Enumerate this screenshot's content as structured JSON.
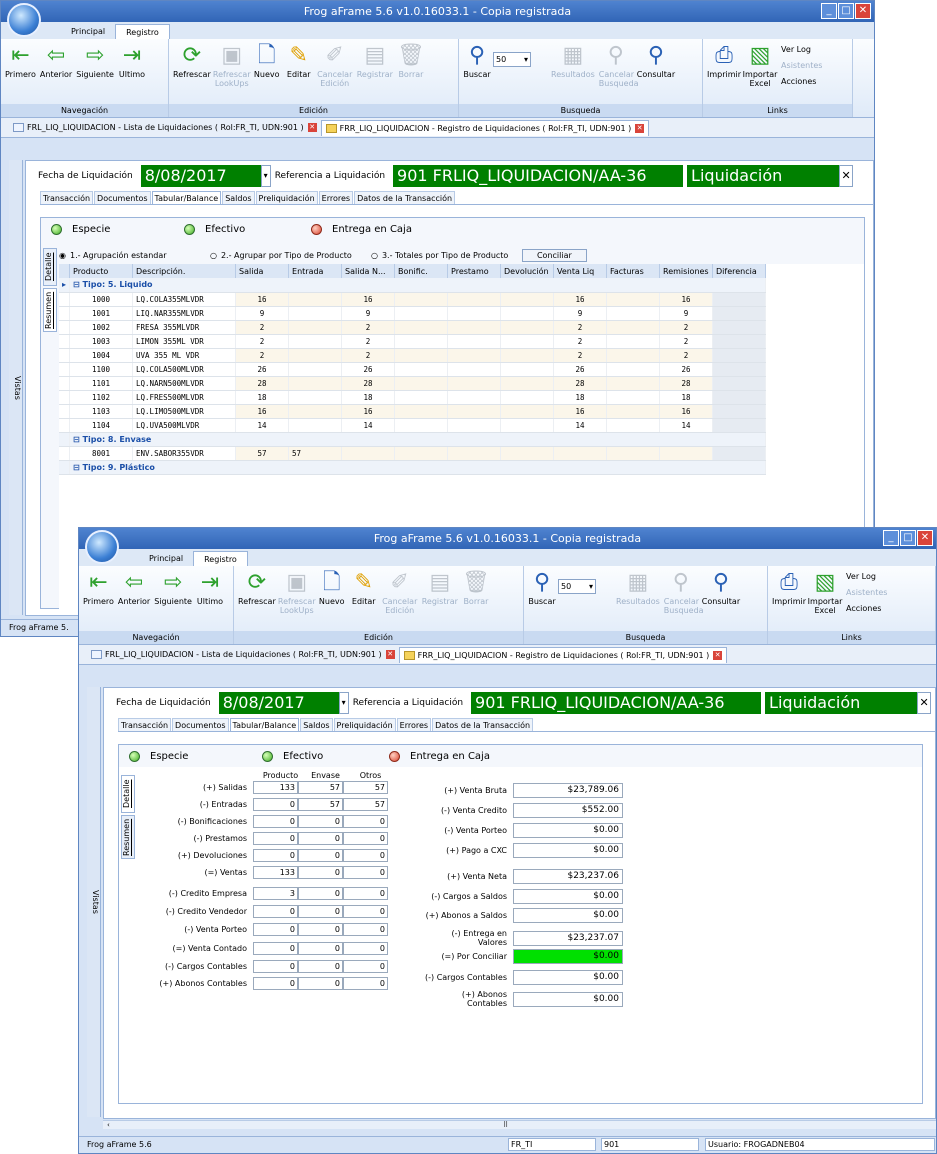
{
  "app": {
    "title": "Frog aFrame 5.6 v1.0.16033.1 - Copia registrada"
  },
  "ribbon": {
    "tabs": [
      "Principal",
      "Registro"
    ],
    "nav": [
      "Primero",
      "Anterior",
      "Siguiente",
      "Ultimo"
    ],
    "nav_label": "Navegación",
    "edit": [
      "Refrescar",
      "Refrescar LookUps",
      "Nuevo",
      "Editar",
      "Cancelar Edición",
      "Registrar",
      "Borrar"
    ],
    "edit_label": "Edición",
    "search": {
      "buscar": "Buscar",
      "count": "50",
      "resultados": "Resultados",
      "cancelar": "Cancelar Busqueda",
      "consultar": "Consultar"
    },
    "search_label": "Busqueda",
    "links": {
      "imprimir": "Imprimir",
      "importar": "Importar Excel",
      "verlog": "Ver Log",
      "asistentes": "Asistentes",
      "acciones": "Acciones"
    },
    "links_label": "Links"
  },
  "doctabs": [
    "FRL_LIQ_LIQUIDACION - Lista de Liquidaciones ( Rol:FR_TI, UDN:901 )",
    "FRR_LIQ_LIQUIDACION - Registro de Liquidaciones ( Rol:FR_TI, UDN:901 )"
  ],
  "vistas": "Vistas",
  "header": {
    "fecha_label": "Fecha de Liquidación",
    "fecha": "8/08/2017",
    "ref_label": "Referencia a Liquidación",
    "ref": "901 FRLIQ_LIQUIDACION/AA-36",
    "status": "Liquidación Abierta"
  },
  "subtabs": [
    "Transacción",
    "Documentos",
    "Tabular/Balance",
    "Saldos",
    "Preliquidación",
    "Errores",
    "Datos de la Transacción"
  ],
  "legend": [
    "Especie",
    "Efectivo",
    "Entrega en Caja"
  ],
  "vtabs": {
    "detalle": "Detalle",
    "resumen": "Resumen"
  },
  "options": {
    "o1": "1.- Agrupación estandar",
    "o2": "2.- Agrupar por Tipo de Producto",
    "o3": "3.- Totales por Tipo de Producto",
    "conciliar": "Conciliar"
  },
  "grid": {
    "columns": [
      "Producto",
      "Descripción.",
      "Salida",
      "Entrada",
      "Salida N...",
      "Bonific.",
      "Prestamo",
      "Devolución",
      "Venta Liq",
      "Facturas",
      "Remisiones",
      "Diferencia"
    ],
    "groups": [
      {
        "title": "Tipo: 5. Liquido",
        "rows": [
          [
            "1000",
            "LQ.COLA355MLVDR",
            "16",
            "",
            "16",
            "",
            "",
            "",
            "16",
            "",
            "16",
            ""
          ],
          [
            "1001",
            "LIQ.NAR355MLVDR",
            "9",
            "",
            "9",
            "",
            "",
            "",
            "9",
            "",
            "9",
            ""
          ],
          [
            "1002",
            "FRESA 355MLVDR",
            "2",
            "",
            "2",
            "",
            "",
            "",
            "2",
            "",
            "2",
            ""
          ],
          [
            "1003",
            "LIMON 355ML VDR",
            "2",
            "",
            "2",
            "",
            "",
            "",
            "2",
            "",
            "2",
            ""
          ],
          [
            "1004",
            "UVA 355 ML VDR",
            "2",
            "",
            "2",
            "",
            "",
            "",
            "2",
            "",
            "2",
            ""
          ],
          [
            "1100",
            "LQ.COLA500MLVDR",
            "26",
            "",
            "26",
            "",
            "",
            "",
            "26",
            "",
            "26",
            ""
          ],
          [
            "1101",
            "LQ.NARN500MLVDR",
            "28",
            "",
            "28",
            "",
            "",
            "",
            "28",
            "",
            "28",
            ""
          ],
          [
            "1102",
            "LQ.FRES500MLVDR",
            "18",
            "",
            "18",
            "",
            "",
            "",
            "18",
            "",
            "18",
            ""
          ],
          [
            "1103",
            "LQ.LIMO500MLVDR",
            "16",
            "",
            "16",
            "",
            "",
            "",
            "16",
            "",
            "16",
            ""
          ],
          [
            "1104",
            "LQ.UVA500MLVDR",
            "14",
            "",
            "14",
            "",
            "",
            "",
            "14",
            "",
            "14",
            ""
          ]
        ]
      },
      {
        "title": "Tipo: 8. Envase",
        "rows": [
          [
            "8001",
            "ENV.SABOR355VDR",
            "57",
            "57",
            "",
            "",
            "",
            "",
            "",
            "",
            "",
            ""
          ]
        ]
      },
      {
        "title": "Tipo: 9. Plástico",
        "rows": []
      }
    ]
  },
  "balance": {
    "col_headers": [
      "Producto",
      "Envase",
      "Otros"
    ],
    "left": [
      {
        "label": "(+) Salidas",
        "v": [
          "133",
          "57",
          "57"
        ]
      },
      {
        "label": "(-) Entradas",
        "v": [
          "0",
          "57",
          "57"
        ]
      },
      {
        "label": "(-) Bonificaciones",
        "v": [
          "0",
          "0",
          "0"
        ]
      },
      {
        "label": "(-) Prestamos",
        "v": [
          "0",
          "0",
          "0"
        ]
      },
      {
        "label": "(+) Devoluciones",
        "v": [
          "0",
          "0",
          "0"
        ]
      },
      {
        "label": "(=) Ventas",
        "v": [
          "133",
          "0",
          "0"
        ]
      },
      {
        "label": "(-) Credito Empresa",
        "v": [
          "3",
          "0",
          "0"
        ]
      },
      {
        "label": "(-) Credito Vendedor",
        "v": [
          "0",
          "0",
          "0"
        ]
      },
      {
        "label": "(-) Venta Porteo",
        "v": [
          "0",
          "0",
          "0"
        ]
      },
      {
        "label": "(=) Venta Contado",
        "v": [
          "0",
          "0",
          "0"
        ]
      },
      {
        "label": "(-) Cargos Contables",
        "v": [
          "0",
          "0",
          "0"
        ]
      },
      {
        "label": "(+) Abonos Contables",
        "v": [
          "0",
          "0",
          "0"
        ]
      }
    ],
    "right": [
      {
        "label": "(+) Venta Bruta",
        "v": "$23,789.06"
      },
      {
        "label": "(-) Venta Credito",
        "v": "$552.00"
      },
      {
        "label": "(-) Venta Porteo",
        "v": "$0.00"
      },
      {
        "label": "(+) Pago a CXC",
        "v": "$0.00"
      },
      {
        "label": "(+) Venta Neta",
        "v": "$23,237.06"
      },
      {
        "label": "(-) Cargos a Saldos",
        "v": "$0.00"
      },
      {
        "label": "(+) Abonos a Saldos",
        "v": "$0.00"
      },
      {
        "label": "(-) Entrega en Valores",
        "v": "$23,237.07"
      },
      {
        "label": "(=) Por Conciliar",
        "v": "$0.00"
      },
      {
        "label": "(-) Cargos Contables",
        "v": "$0.00"
      },
      {
        "label": "(+) Abonos Contables",
        "v": "$0.00"
      }
    ]
  },
  "status": {
    "app": "Frog aFrame 5.6",
    "app_short": "Frog aFrame 5.",
    "rol": "FR_TI",
    "udn": "901",
    "usuario": "Usuario: FROGADNEB04"
  },
  "colors": {
    "green": "#008000",
    "highlight": "#00e000",
    "accent": "#3165b6"
  }
}
